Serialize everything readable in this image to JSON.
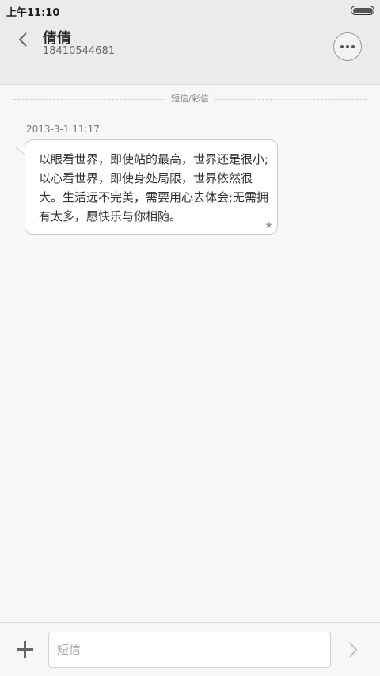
{
  "status_bar": {
    "time": "上午11:10",
    "battery_icon": "battery-icon"
  },
  "header": {
    "back_icon": "chevron-left-icon",
    "contact_name": "倩倩",
    "contact_number": "18410544681",
    "more_icon": "more-dots-icon"
  },
  "divider": {
    "label": "短信/彩信"
  },
  "messages": [
    {
      "timestamp": "2013-3-1 11:17",
      "text": "以眼看世界，即使站的最高，世界还是很小;以心看世界，即使身处局限，世界依然很大。生活远不完美，需要用心去体会;无需拥有太多，愿快乐与你相随。",
      "starred": true
    }
  ],
  "input_bar": {
    "add_icon": "plus-icon",
    "placeholder": "短信",
    "value": "",
    "send_icon": "chevron-right-icon"
  },
  "colors": {
    "header_bg": "#ebebeb",
    "page_bg": "#f7f7f7",
    "bubble_bg": "#ffffff",
    "text": "#333333"
  }
}
